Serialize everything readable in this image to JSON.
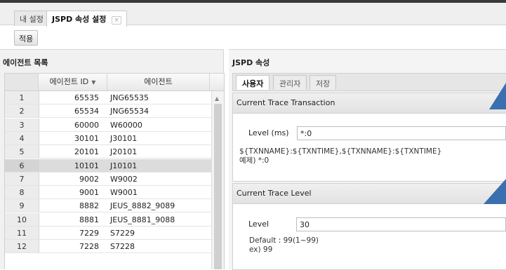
{
  "tabs": [
    {
      "label": "내 설정",
      "active": false
    },
    {
      "label": "JSPD 속성 설정",
      "active": true,
      "close": "×"
    }
  ],
  "toolbar": {
    "apply_label": "적용"
  },
  "agent_list": {
    "title": "에이전트 목록",
    "columns": {
      "id": "에이전트 ID",
      "name": "에이전트"
    },
    "sort_icon": "▼",
    "rows": [
      {
        "num": "1",
        "id": "65535",
        "name": "JNG65535"
      },
      {
        "num": "2",
        "id": "65534",
        "name": "JNG65534"
      },
      {
        "num": "3",
        "id": "60000",
        "name": "W60000"
      },
      {
        "num": "4",
        "id": "30101",
        "name": "J30101"
      },
      {
        "num": "5",
        "id": "20101",
        "name": "J20101"
      },
      {
        "num": "6",
        "id": "10101",
        "name": "J10101",
        "selected": true
      },
      {
        "num": "7",
        "id": "9002",
        "name": "W9002"
      },
      {
        "num": "8",
        "id": "9001",
        "name": "W9001"
      },
      {
        "num": "9",
        "id": "8882",
        "name": "JEUS_8882_9089"
      },
      {
        "num": "10",
        "id": "8881",
        "name": "JEUS_8881_9088"
      },
      {
        "num": "11",
        "id": "7229",
        "name": "S7229"
      },
      {
        "num": "12",
        "id": "7228",
        "name": "S7228"
      }
    ]
  },
  "jspd": {
    "title": "JSPD 속성",
    "tabs": [
      "사용자",
      "관리자",
      "저장"
    ],
    "sections": {
      "transaction": {
        "title": "Current Trace Transaction",
        "label": "Level (ms)",
        "value": "*:0",
        "hint": "${TXNNAME}:${TXNTIME},${TXNNAME}:${TXNTIME}\n예제) *:0"
      },
      "level": {
        "title": "Current Trace Level",
        "label": "Level",
        "value": "30",
        "hint": "Default : 99(1~99)\nex) 99"
      }
    }
  },
  "colors": {
    "callout": "#3a6fb0",
    "selected_row": "#dcdcdc"
  }
}
